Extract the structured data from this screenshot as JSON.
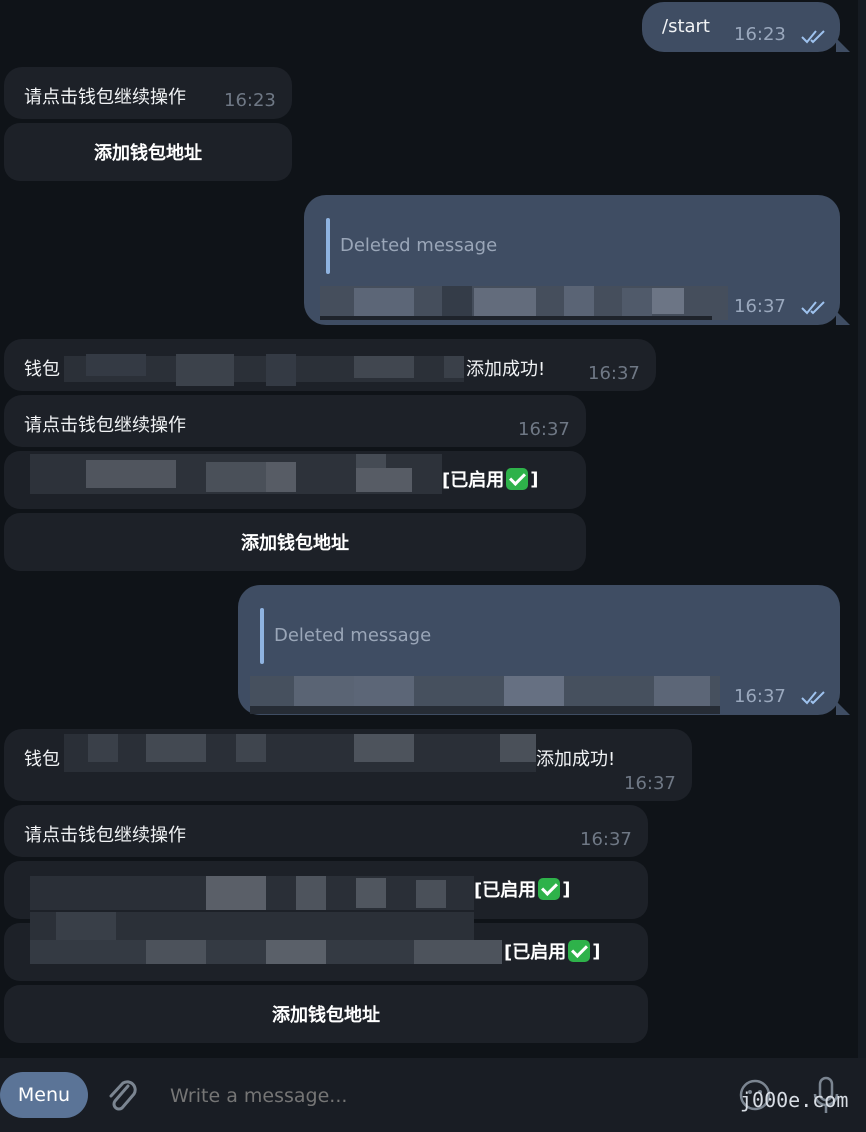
{
  "messages": {
    "m1": {
      "text": "/start",
      "time": "16:23"
    },
    "m2": {
      "text": "请点击钱包继续操作",
      "time": "16:23",
      "button": "添加钱包地址"
    },
    "m3": {
      "quote": "Deleted message",
      "time": "16:37"
    },
    "m4": {
      "prefix": "钱包",
      "suffix": "添加成功!",
      "time": "16:37"
    },
    "m5": {
      "text": "请点击钱包继续操作",
      "time": "16:37",
      "wallet_status": "[已启用",
      "wallet_status_close": "]",
      "button": "添加钱包地址"
    },
    "m6": {
      "quote": "Deleted message",
      "time": "16:37"
    },
    "m7": {
      "prefix": "钱包",
      "suffix": "添加成功!",
      "time": "16:37"
    },
    "m8": {
      "text": "请点击钱包继续操作",
      "time": "16:37",
      "wallet1_status": "[已启用",
      "wallet1_close": "]",
      "wallet2_status": "[已启用",
      "wallet2_close": "]",
      "button": "添加钱包地址"
    }
  },
  "composer": {
    "menu_label": "Menu",
    "placeholder": "Write a message..."
  },
  "watermark": "j000e.com",
  "colors": {
    "incoming_bubble": "#1d2128",
    "outgoing_bubble": "#3f4d63",
    "menu_button": "#5b7497",
    "check_badge": "#2eb24a"
  }
}
